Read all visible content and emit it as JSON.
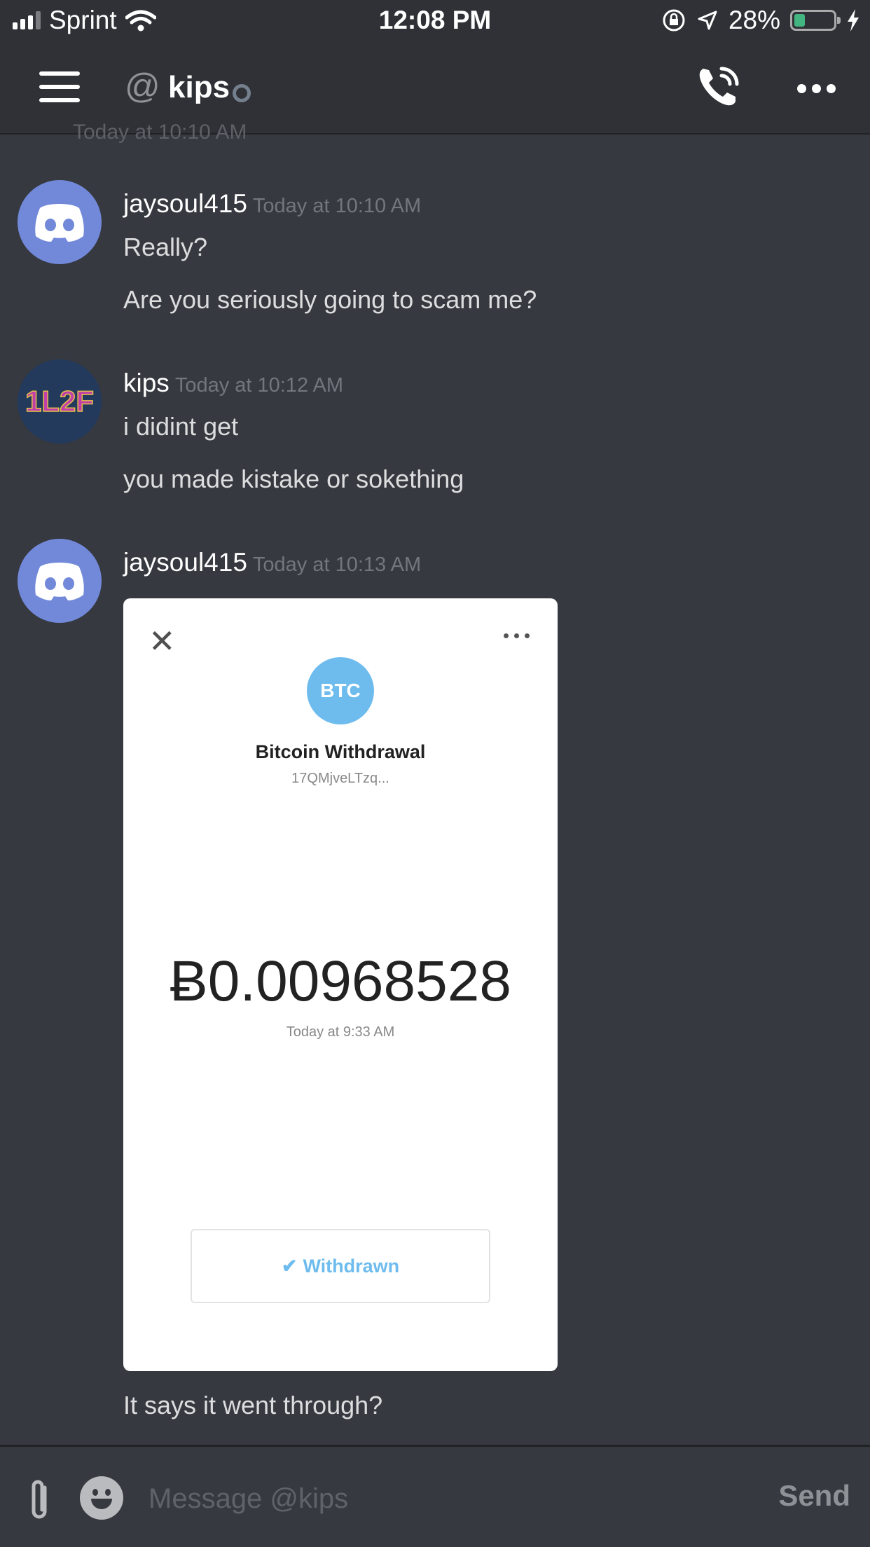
{
  "status_bar": {
    "carrier": "Sprint",
    "time": "12:08 PM",
    "battery": "28%",
    "battery_level": 0.28
  },
  "header": {
    "channel_name": "kips",
    "icons": [
      "menu-icon",
      "at-icon",
      "call-icon",
      "more-icon"
    ]
  },
  "faded_timestamp": "Today at 10:10 AM",
  "messages": [
    {
      "author": "jaysoul415",
      "timestamp": "Today at 10:10 AM",
      "lines": [
        "Really?",
        "Are you seriously going to scam me?"
      ]
    },
    {
      "author": "kips",
      "timestamp": "Today at 10:12 AM",
      "lines": [
        "i didint get",
        "you made kistake or sokething"
      ]
    },
    {
      "author": "jaysoul415",
      "timestamp": "Today at 10:13 AM",
      "lines": [
        "It says it went through?"
      ]
    }
  ],
  "kips_avatar_text": "1L2F",
  "attachment": {
    "badge": "BTC",
    "title": "Bitcoin Withdrawal",
    "address": "17QMjveLTzq...",
    "amount": "Ƀ0.00968528",
    "time": "Today at 9:33 AM",
    "status": "Withdrawn"
  },
  "composer": {
    "placeholder": "Message @kips",
    "send_label": "Send"
  },
  "colors": {
    "background": "#36393f",
    "header": "#2f3136",
    "discord_blurple": "#7289da",
    "btc_blue": "#6ebcee"
  }
}
